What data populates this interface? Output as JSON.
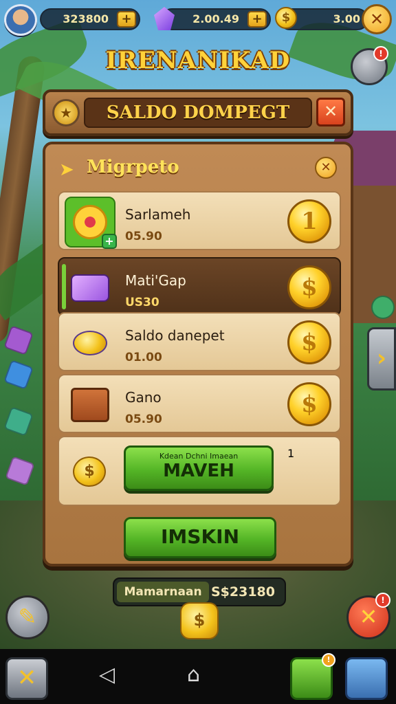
{
  "hud": {
    "coins": "323800",
    "crystals": "2.00.49",
    "gold": "3.00",
    "plus_label": "+",
    "close_label": "✕"
  },
  "game_title": "IRENANIKAD",
  "mail_badge": "!",
  "banner": {
    "title": "SALDO DOMPEGT",
    "close_label": "✕"
  },
  "panel": {
    "title": "Migrpeto",
    "close_label": "✕",
    "rows": [
      {
        "name": "Sarlameh",
        "price": "05.90",
        "coin_glyph": "1"
      },
      {
        "name": "Mati'Gap",
        "price": "US30",
        "coin_glyph": "$"
      },
      {
        "name": "Saldo danepet",
        "price": "01.00",
        "coin_glyph": "$"
      },
      {
        "name": "Gano",
        "price": "05.90",
        "coin_glyph": "$"
      }
    ],
    "offer": {
      "caption": "Kdean Dchni Imaean",
      "button_label": "MAVEH",
      "coin_glyph": "1"
    },
    "main_button_label": "IMSKIN"
  },
  "footer": {
    "left_label": "Mamarnaan",
    "right_value": "S$23180"
  },
  "bottom_right_badge": "!",
  "nav_badge": "!",
  "colors": {
    "accent_gold": "#ffd23a",
    "panel_wood": "#a8743f",
    "button_green": "#54b526",
    "close_red": "#d8421d"
  }
}
